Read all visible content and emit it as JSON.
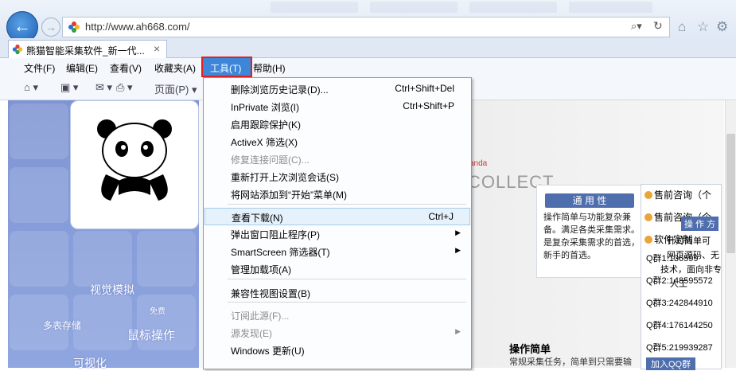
{
  "window": {
    "address_url": "http://www.ah668.com/",
    "tab_title": "熊猫智能采集软件_新一代...",
    "tab_close": "×"
  },
  "menubar": {
    "items": [
      "文件(F)",
      "编辑(E)",
      "查看(V)",
      "收藏夹(A)",
      "工具(T)",
      "帮助(H)"
    ],
    "active": "工具(T)"
  },
  "commandbar": {
    "page_label": "页面(P)"
  },
  "tools_menu": {
    "items": [
      {
        "label": "删除浏览历史记录(D)...",
        "shortcut": "Ctrl+Shift+Del",
        "disabled": false
      },
      {
        "label": "InPrivate 浏览(I)",
        "shortcut": "Ctrl+Shift+P",
        "disabled": false
      },
      {
        "label": "启用跟踪保护(K)",
        "shortcut": "",
        "disabled": false
      },
      {
        "label": "ActiveX 筛选(X)",
        "shortcut": "",
        "disabled": false
      },
      {
        "label": "修复连接问题(C)...",
        "shortcut": "",
        "disabled": true
      },
      {
        "label": "重新打开上次浏览会话(S)",
        "shortcut": "",
        "disabled": false
      },
      {
        "label": "将网站添加到“开始”菜单(M)",
        "shortcut": "",
        "disabled": false
      },
      {
        "label": "查看下载(N)",
        "shortcut": "Ctrl+J",
        "disabled": false,
        "highlighted": true
      },
      {
        "label": "弹出窗口阻止程序(P)",
        "shortcut": "",
        "submenu": true,
        "disabled": false
      },
      {
        "label": "SmartScreen 筛选器(T)",
        "shortcut": "",
        "submenu": true,
        "disabled": false
      },
      {
        "label": "管理加载项(A)",
        "shortcut": "",
        "disabled": false
      },
      {
        "label": "兼容性视图设置(B)",
        "shortcut": "",
        "disabled": false
      },
      {
        "label": "订阅此源(F)...",
        "shortcut": "",
        "disabled": true
      },
      {
        "label": "源发现(E)",
        "shortcut": "",
        "submenu": true,
        "disabled": true
      },
      {
        "label": "Windows 更新(U)",
        "shortcut": "",
        "disabled": false
      }
    ]
  },
  "page": {
    "left_texts": [
      "视觉模拟",
      "鼠标操作",
      "多表存储",
      "可视化",
      "免费"
    ],
    "collect_text": "COLLECT",
    "brand_small": "anda",
    "feature_title": "通 用 性",
    "feature_body": "操作简单与功能复杂兼备。满足各类采集需求。是复杂采集需求的首选，新手的首选。",
    "op_title": "操作简单",
    "op_body": "常规采集任务，简单到只需要输",
    "qq_heads": [
      "售前咨询（个",
      "售前咨询（企",
      "软件定制"
    ],
    "qq_rows": [
      "Q群1:136599",
      "Q群2:148595572",
      "Q群3:242844910",
      "Q群4:176144250",
      "Q群5:219939287",
      "加入QQ群"
    ],
    "overlay_texts": [
      "操 作 方",
      "针对简单可",
      "网页源码、无",
      "技术，面向非专",
      "人工"
    ]
  }
}
